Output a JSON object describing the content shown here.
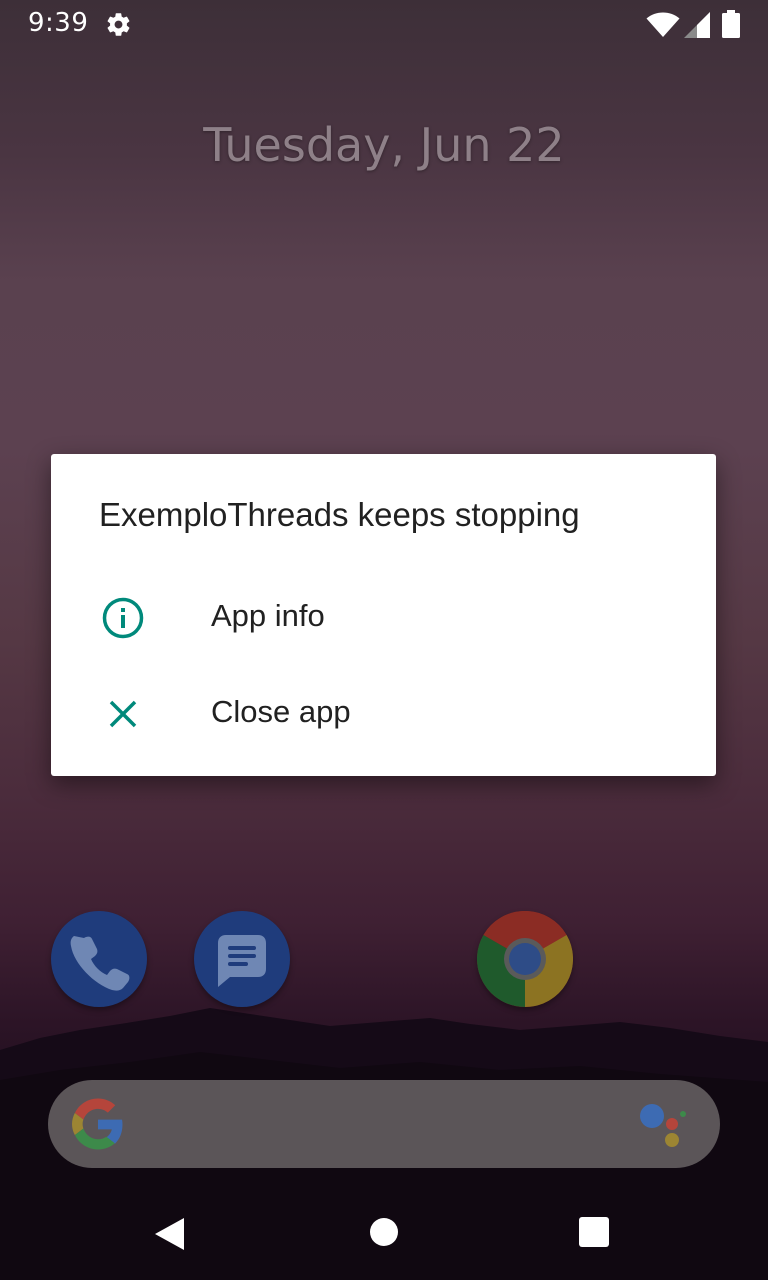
{
  "status_bar": {
    "time": "9:39",
    "icons": [
      "gear-icon",
      "wifi-icon",
      "signal-icon",
      "battery-icon"
    ]
  },
  "lock_screen": {
    "date": "Tuesday, Jun 22"
  },
  "dialog": {
    "title": "ExemploThreads keeps stopping",
    "items": [
      {
        "label": "App info",
        "icon": "info-icon"
      },
      {
        "label": "Close app",
        "icon": "close-icon"
      }
    ],
    "accent_color": "#00897b"
  },
  "home_dock": {
    "apps": [
      "phone-icon",
      "messages-icon",
      "chrome-icon"
    ]
  },
  "search_bar": {
    "icons": [
      "google-g-icon",
      "assistant-icon"
    ]
  },
  "nav_bar": {
    "buttons": [
      "back-icon",
      "home-icon",
      "recents-icon"
    ]
  }
}
